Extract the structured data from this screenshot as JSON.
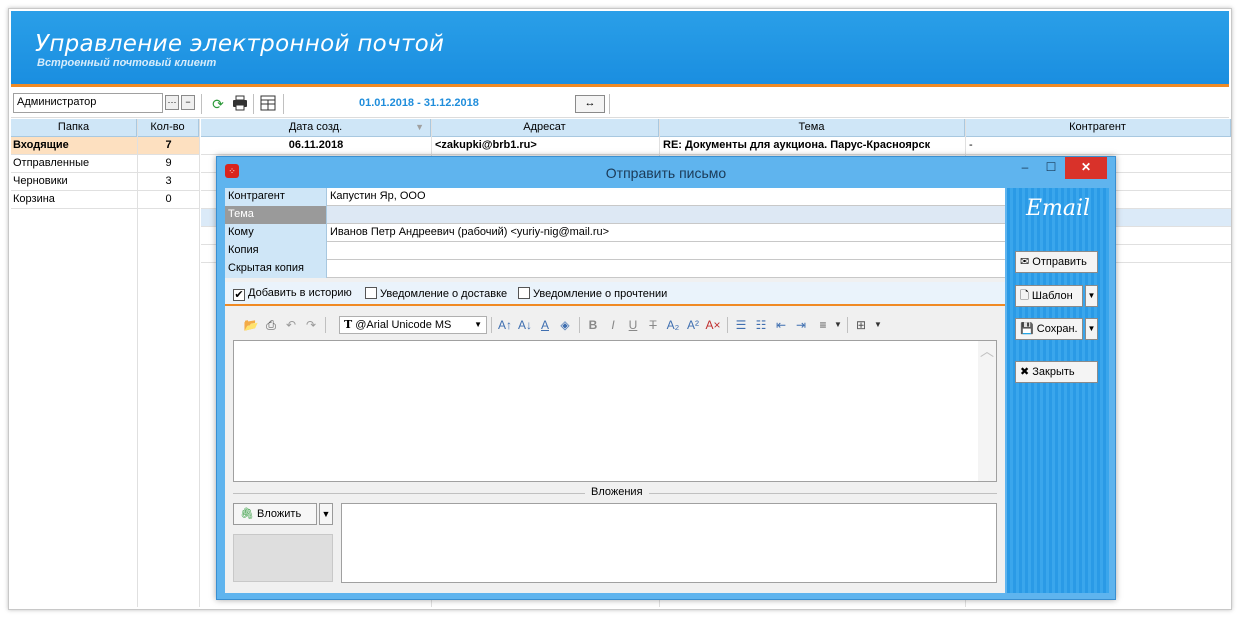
{
  "app": {
    "title": "Управление электронной почтой",
    "subtitle": "Встроенный почтовый клиент"
  },
  "toolbar": {
    "user": "Администратор",
    "ellipsis": "···",
    "minus": "−",
    "date_range": "01.01.2018 - 31.12.2018",
    "range_toggle": "↔"
  },
  "folders": {
    "headers": {
      "name": "Папка",
      "count": "Кол-во"
    },
    "items": [
      {
        "name": "Входящие",
        "count": "7"
      },
      {
        "name": "Отправленные",
        "count": "9"
      },
      {
        "name": "Черновики",
        "count": "3"
      },
      {
        "name": "Корзина",
        "count": "0"
      }
    ]
  },
  "mails": {
    "headers": {
      "date": "Дата созд.",
      "to": "Адресат",
      "subject": "Тема",
      "contractor": "Контрагент"
    },
    "rows": [
      {
        "date": "06.11.2018",
        "to": "<zakupki@brb1.ru>",
        "subject": "RE: Документы для аукциона. Парус-Красноярск",
        "contractor": "-"
      }
    ]
  },
  "dialog": {
    "title": "Отправить письмо",
    "min": "–",
    "max": "☐",
    "close": "✕",
    "fields": {
      "contractor": {
        "label": "Контрагент",
        "value": "Капустин Яр, ООО"
      },
      "subject": {
        "label": "Тема",
        "value": ""
      },
      "to": {
        "label": "Кому",
        "value": "Иванов Петр Андреевич (рабочий) <yuriy-nig@mail.ru>"
      },
      "cc": {
        "label": "Копия",
        "value": ""
      },
      "bcc": {
        "label": "Скрытая копия",
        "value": ""
      }
    },
    "checks": {
      "history": {
        "label": "Добавить в историю",
        "checked": true
      },
      "delivery": {
        "label": "Уведомление о доставке",
        "checked": false
      },
      "read": {
        "label": "Уведомление о прочтении",
        "checked": false
      }
    },
    "font": "@Arial Unicode MS",
    "attachments_label": "Вложения",
    "attach_button": "Вложить",
    "side": {
      "brand": "Email",
      "send": "Отправить",
      "template": "Шаблон",
      "save": "Сохран.",
      "close": "Закрыть"
    }
  }
}
